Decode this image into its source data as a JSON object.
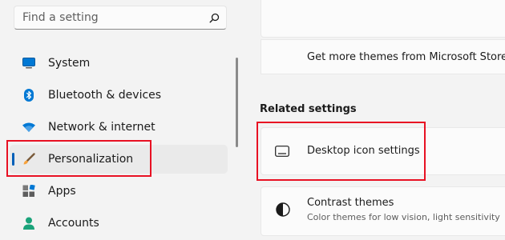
{
  "search": {
    "placeholder": "Find a setting",
    "icon": "search-icon"
  },
  "sidebar": {
    "items": [
      {
        "label": "System",
        "icon": "system-monitor-icon"
      },
      {
        "label": "Bluetooth & devices",
        "icon": "bluetooth-icon"
      },
      {
        "label": "Network & internet",
        "icon": "wifi-icon"
      },
      {
        "label": "Personalization",
        "icon": "paintbrush-icon",
        "selected": true
      },
      {
        "label": "Apps",
        "icon": "apps-icon"
      },
      {
        "label": "Accounts",
        "icon": "account-icon"
      }
    ]
  },
  "themes": {
    "store_link": "Get more themes from Microsoft Store"
  },
  "related_settings": {
    "title": "Related settings",
    "desktop_icons": {
      "label": "Desktop icon settings",
      "icon": "desktop-icon"
    },
    "contrast_themes": {
      "label": "Contrast themes",
      "description": "Color themes for low vision, light sensitivity",
      "icon": "contrast-icon"
    }
  },
  "colors": {
    "accent": "#005fb8",
    "highlight_box": "#e81123",
    "background": "#f3f3f3",
    "card": "#fbfbfb"
  }
}
